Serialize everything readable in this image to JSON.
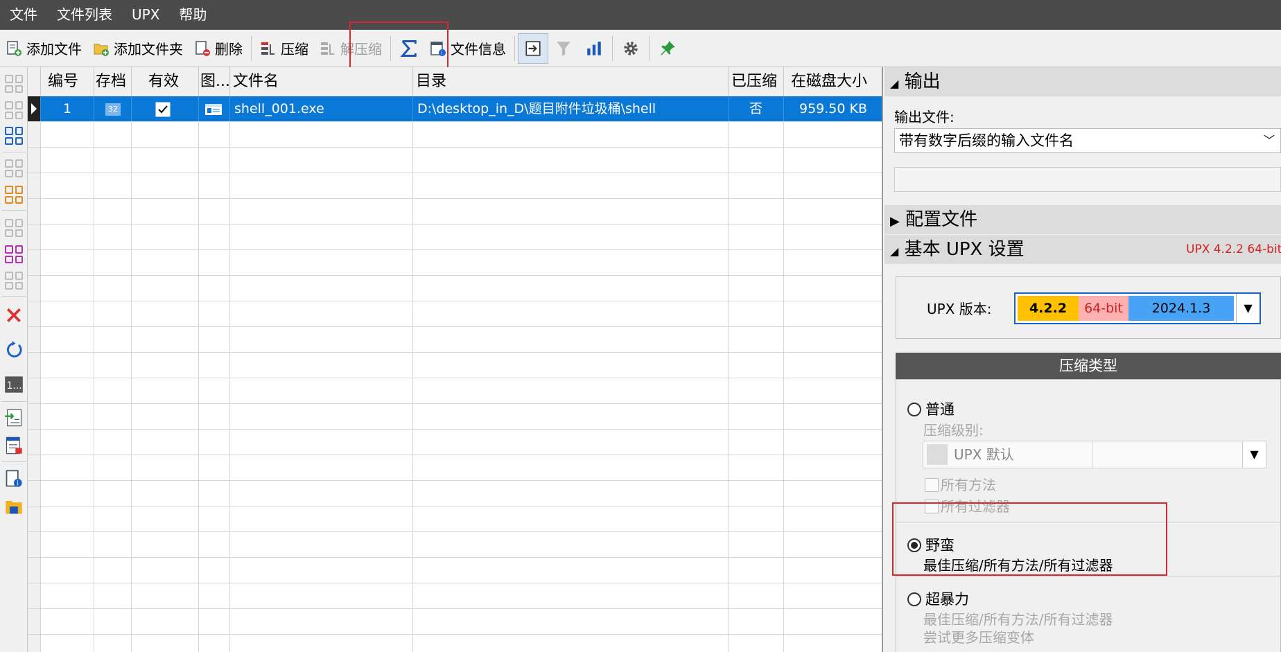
{
  "menu": [
    "文件",
    "文件列表",
    "UPX",
    "帮助"
  ],
  "toolbar": {
    "add_file": "添加文件",
    "add_folder": "添加文件夹",
    "delete": "删除",
    "compress": "压缩",
    "decompress": "解压缩",
    "file_info": "文件信息"
  },
  "table": {
    "headers": [
      "编号",
      "存档",
      "有效",
      "图...",
      "文件名",
      "目录",
      "已压缩",
      "在磁盘大小"
    ],
    "rows": [
      {
        "num": "1",
        "archive": "32",
        "name": "shell_001.exe",
        "dir": "D:\\desktop_in_D\\题目附件垃圾桶\\shell",
        "compressed": "否",
        "size": "959.50 KB"
      }
    ]
  },
  "panel": {
    "output_title": "输出",
    "output_file_label": "输出文件:",
    "output_file_value": "带有数字后缀的输入文件名",
    "config_title": "配置文件",
    "basic_title": "基本 UPX 设置",
    "upx_version_tag": "UPX 4.2.2 64-bit",
    "upx_version_label": "UPX 版本:",
    "ver_num": "4.2.2",
    "ver_bits": "64-bit",
    "ver_date": "2024.1.3",
    "compress_type_title": "压缩类型",
    "opt_normal": "普通",
    "level_label": "压缩级别:",
    "level_value": "UPX 默认",
    "all_methods": "所有方法",
    "all_filters": "所有过滤器",
    "opt_brute": "野蛮",
    "brute_desc": "最佳压缩/所有方法/所有过滤器",
    "opt_ultra": "超暴力",
    "ultra_desc1": "最佳压缩/所有方法/所有过滤器",
    "ultra_desc2": "尝试更多压缩变体"
  },
  "colors": {
    "selection": "#0a78d7",
    "highlight_box": "#d9252b",
    "ver_yellow": "#ffc000",
    "ver_pink": "#ffb0b0",
    "ver_blue": "#46a3f5"
  }
}
